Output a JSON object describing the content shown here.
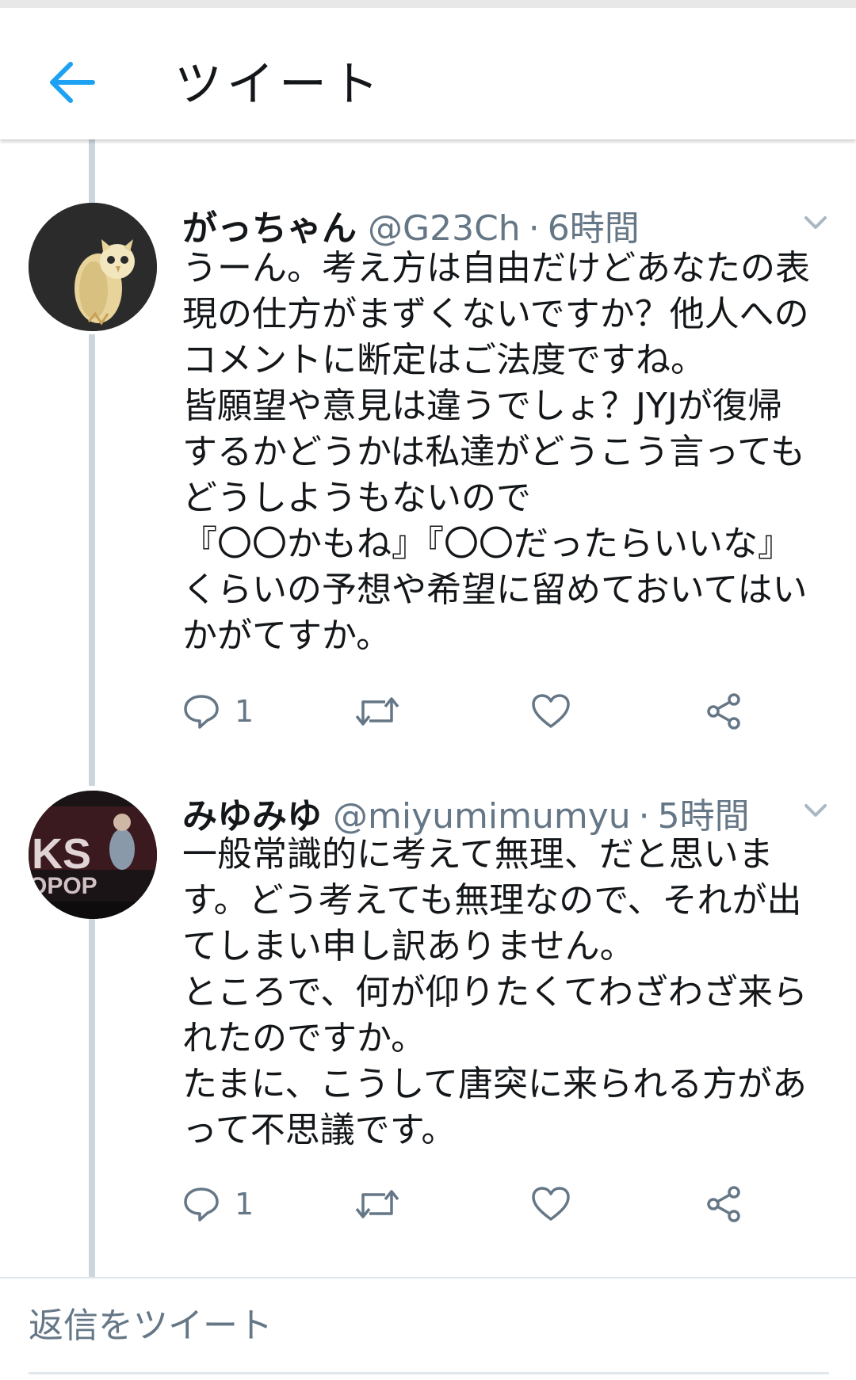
{
  "header": {
    "title": "ツイート",
    "back_icon": "arrow-left-icon"
  },
  "colors": {
    "accent": "#1da1f2",
    "text": "#14171a",
    "secondary": "#657786",
    "thread_line": "#ccd6dd"
  },
  "tweets": [
    {
      "display_name": "がっちゃん",
      "handle": "@G23Ch",
      "separator": "·",
      "time": "6時間",
      "avatar": "owl-avatar",
      "lines": [
        "うーん。考え方は自由だけどあなたの表",
        "現の仕方がまずくないですか？他人への",
        "コメントに断定はご法度ですね。",
        "皆願望や意見は違うでしょ？JYJが復帰",
        "するかどうかは私達がどうこう言っても",
        "どうしようもないので",
        "『〇〇かもね』『〇〇だったらいいな』",
        "くらいの予想や希望に留めておいてはい",
        "かがてすか。"
      ],
      "reply_count": "1"
    },
    {
      "display_name": "みゆみゆ",
      "handle": "@miyumimumyu",
      "separator": "·",
      "time": "5時間",
      "avatar": "stage-photo-avatar",
      "lines": [
        "一般常識的に考えて無理、だと思いま",
        "す。どう考えても無理なので、それが出",
        "てしまい申し訳ありません。",
        "ところで、何が仰りたくてわざわざ来ら",
        "れたのですか。",
        "たまに、こうして唐突に来られる方があ",
        "って不思議です。"
      ],
      "reply_count": "1"
    }
  ],
  "reply_bar": {
    "placeholder": "返信をツイート"
  }
}
